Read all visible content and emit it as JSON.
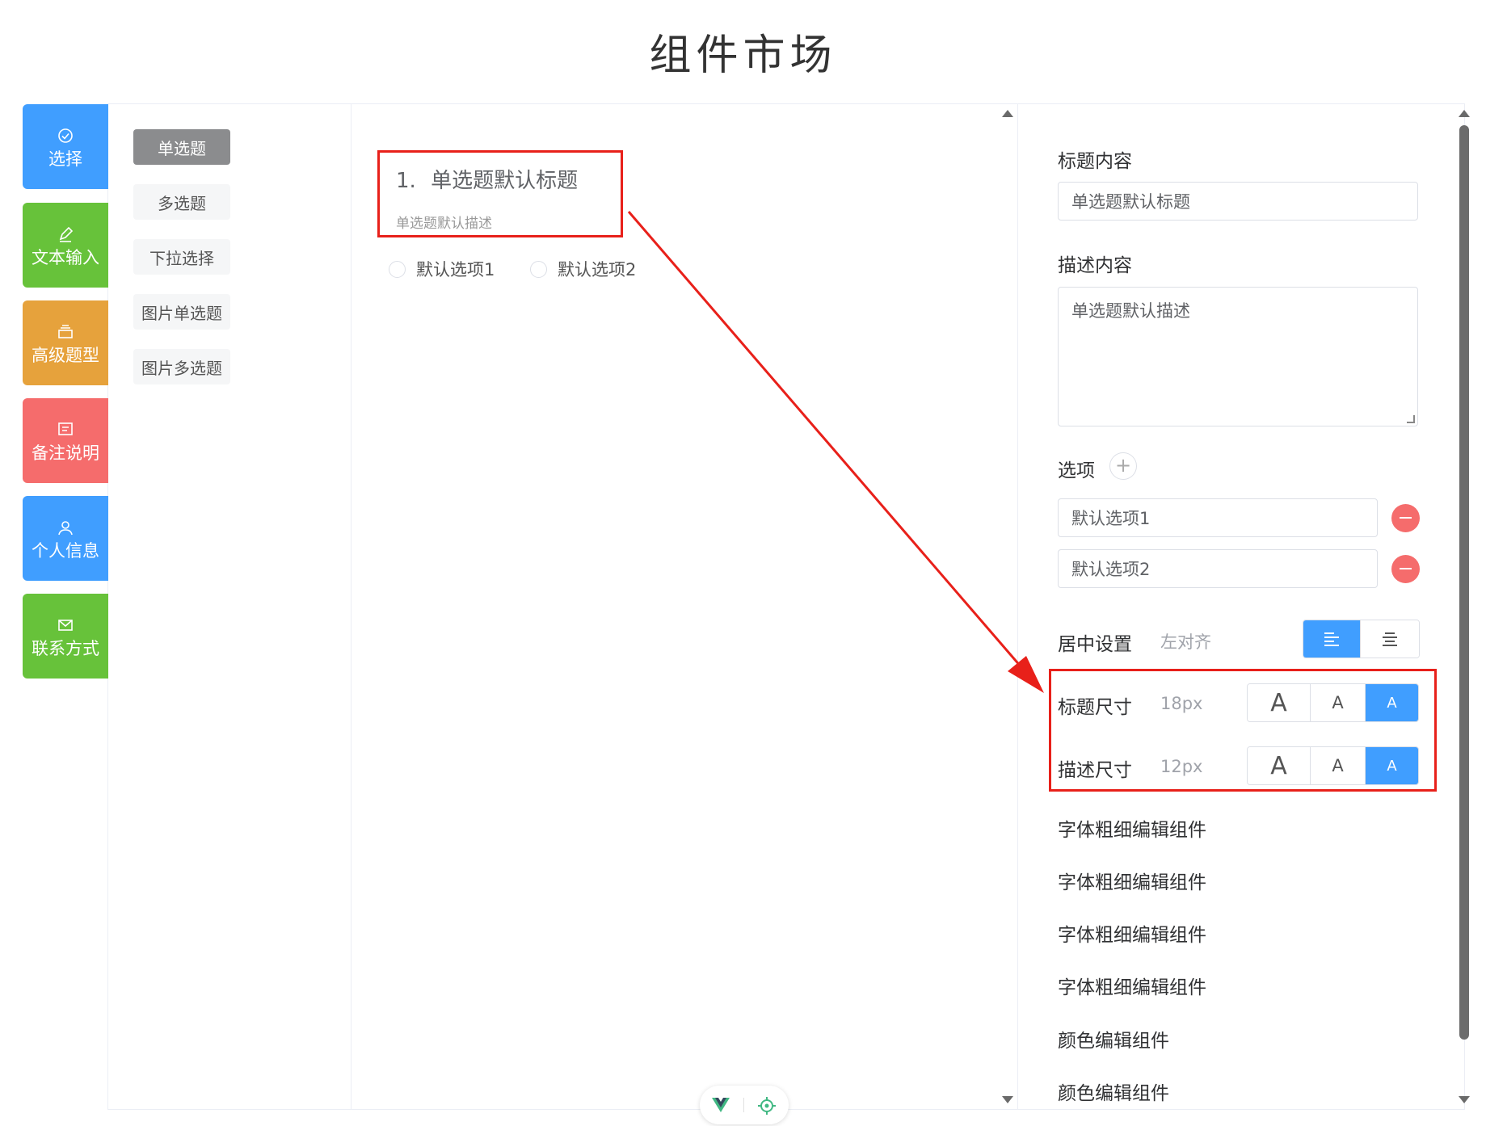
{
  "page": {
    "title": "组件市场"
  },
  "categories": [
    {
      "label": "选择",
      "icon": "check-circle-icon",
      "color": "#409eff"
    },
    {
      "label": "文本输入",
      "icon": "edit-icon",
      "color": "#67c23a"
    },
    {
      "label": "高级题型",
      "icon": "layers-icon",
      "color": "#e6a23c"
    },
    {
      "label": "备注说明",
      "icon": "message-icon",
      "color": "#f56c6c"
    },
    {
      "label": "个人信息",
      "icon": "user-icon",
      "color": "#409eff"
    },
    {
      "label": "联系方式",
      "icon": "mail-icon",
      "color": "#67c23a"
    }
  ],
  "sub_items": [
    "单选题",
    "多选题",
    "下拉选择",
    "图片单选题",
    "图片多选题"
  ],
  "question": {
    "number": "1.",
    "title": "单选题默认标题",
    "desc": "单选题默认描述",
    "options": [
      "默认选项1",
      "默认选项2"
    ]
  },
  "props": {
    "title_label": "标题内容",
    "title_value": "单选题默认标题",
    "desc_label": "描述内容",
    "desc_value": "单选题默认描述",
    "options_label": "选项",
    "plus": "+",
    "option_values": [
      "默认选项1",
      "默认选项2"
    ],
    "align_label": "居中设置",
    "align_value": "左对齐",
    "title_size_label": "标题尺寸",
    "title_size_value": "18px",
    "desc_size_label": "描述尺寸",
    "desc_size_value": "12px",
    "size_glyph": "A",
    "editors": [
      "字体粗细编辑组件",
      "字体粗细编辑组件",
      "字体粗细编辑组件",
      "字体粗细编辑组件",
      "颜色编辑组件",
      "颜色编辑组件"
    ]
  },
  "colors": {
    "accent": "#409eff",
    "danger": "#f56c6c",
    "annotation": "#e8201a"
  }
}
